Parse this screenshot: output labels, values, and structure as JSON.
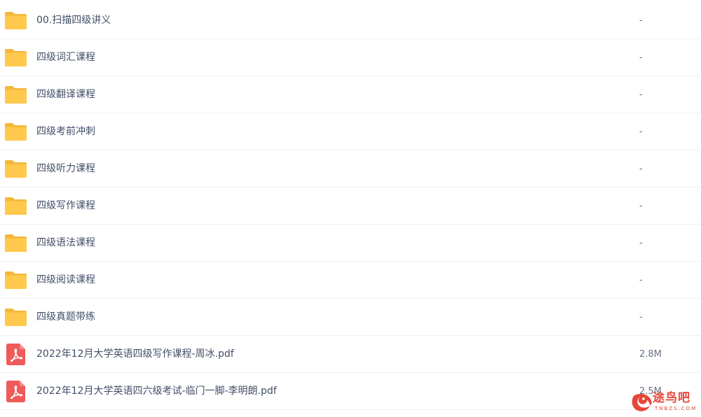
{
  "files": [
    {
      "name": "00.扫描四级讲义",
      "size": "-",
      "icon": "folder-icon"
    },
    {
      "name": "四级词汇课程",
      "size": "-",
      "icon": "folder-icon"
    },
    {
      "name": "四级翻译课程",
      "size": "-",
      "icon": "folder-icon"
    },
    {
      "name": "四级考前冲刺",
      "size": "-",
      "icon": "folder-icon"
    },
    {
      "name": "四级听力课程",
      "size": "-",
      "icon": "folder-icon"
    },
    {
      "name": "四级写作课程",
      "size": "-",
      "icon": "folder-icon"
    },
    {
      "name": "四级语法课程",
      "size": "-",
      "icon": "folder-icon"
    },
    {
      "name": "四级阅读课程",
      "size": "-",
      "icon": "folder-icon"
    },
    {
      "name": "四级真题带练",
      "size": "-",
      "icon": "folder-icon"
    },
    {
      "name": "2022年12月大学英语四级写作课程-周冰.pdf",
      "size": "2.8M",
      "icon": "pdf-icon"
    },
    {
      "name": "2022年12月大学英语四六级考试-临门一脚-李明朗.pdf",
      "size": "2.5M",
      "icon": "pdf-icon"
    }
  ],
  "watermark": {
    "text": "途鸟吧",
    "subtext": "TNBZS.COM"
  },
  "colors": {
    "folder": "#ffc94d",
    "pdf": "#ef5a5a",
    "text": "#424e67",
    "watermark": "#e8463a"
  }
}
